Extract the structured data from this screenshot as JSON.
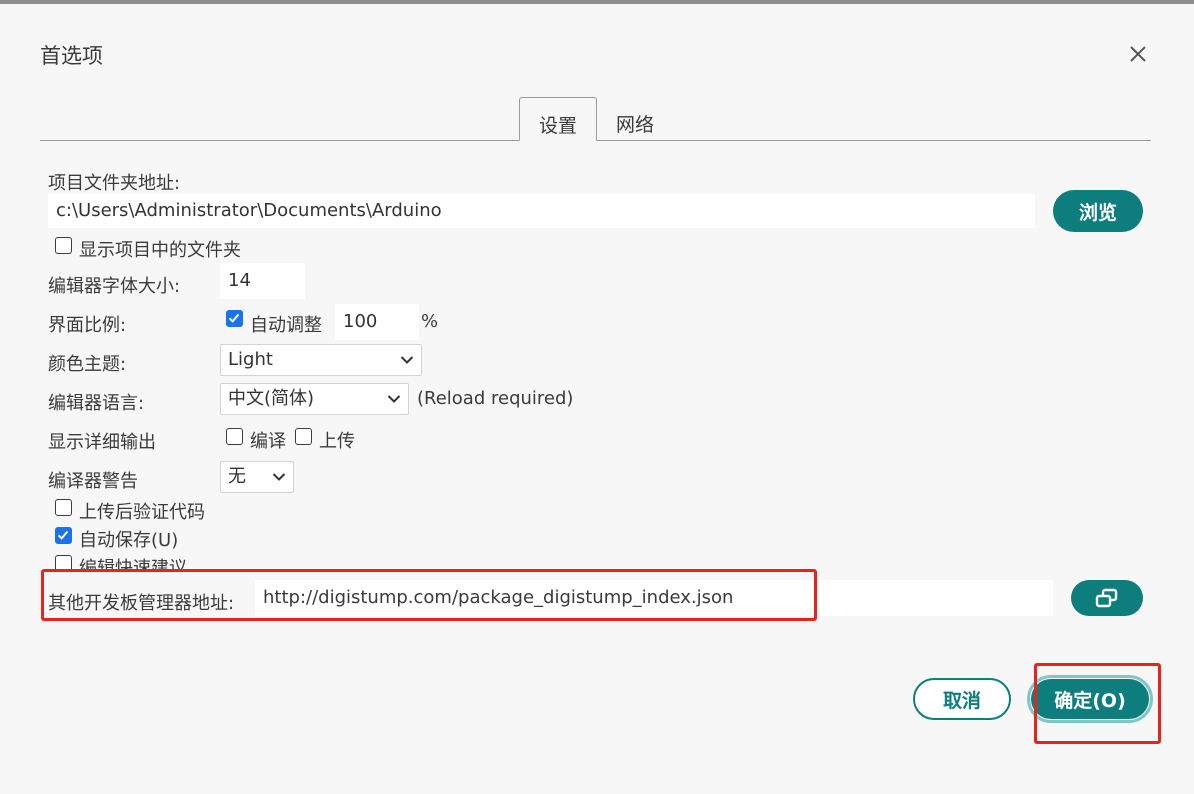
{
  "dialog": {
    "title": "首选项",
    "close_icon": "close-icon"
  },
  "tabs": [
    {
      "label": "设置",
      "active": true
    },
    {
      "label": "网络",
      "active": false
    }
  ],
  "settings": {
    "sketchbook_label": "项目文件夹地址:",
    "sketchbook_value": "c:\\Users\\Administrator\\Documents\\Arduino",
    "browse_label": "浏览",
    "show_files_label": "显示项目中的文件夹",
    "show_files_checked": false,
    "font_size_label": "编辑器字体大小:",
    "font_size_value": "14",
    "scale_label": "界面比例:",
    "auto_scale_label": "自动调整",
    "auto_scale_checked": true,
    "scale_value": "100",
    "scale_unit": "%",
    "theme_label": "颜色主题:",
    "theme_value": "Light",
    "language_label": "编辑器语言:",
    "language_value": "中文(简体)",
    "language_note": "(Reload required)",
    "verbose_label": "显示详细输出",
    "verbose_compile_label": "编译",
    "verbose_compile_checked": false,
    "verbose_upload_label": "上传",
    "verbose_upload_checked": false,
    "warnings_label": "编译器警告",
    "warnings_value": "无",
    "verify_label": "上传后验证代码",
    "verify_checked": false,
    "autosave_label": "自动保存(U)",
    "autosave_checked": true,
    "quick_suggest_label": "编辑快速建议",
    "quick_suggest_checked": false,
    "board_urls_label": "其他开发板管理器地址:",
    "board_urls_value": "http://digistump.com/package_digistump_index.json",
    "board_urls_icon": "open-window-icon"
  },
  "footer": {
    "cancel_label": "取消",
    "ok_label": "确定(O)"
  },
  "colors": {
    "accent": "#0d7d7d",
    "highlight_box": "#e8221c",
    "checkbox_checked": "#1a73e8"
  }
}
